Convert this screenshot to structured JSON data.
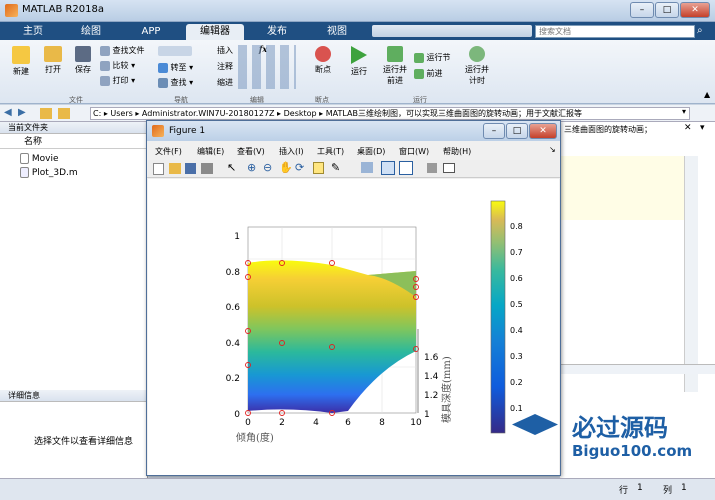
{
  "app": {
    "title": "MATLAB R2018a"
  },
  "tabs": [
    "主页",
    "绘图",
    "APP",
    "编辑器",
    "发布",
    "视图"
  ],
  "active_tab": 3,
  "search": {
    "placeholder": "搜索文档"
  },
  "ribbon": {
    "file": {
      "new": "新建",
      "open": "打开",
      "save": "保存",
      "find_files": "查找文件",
      "compare": "比较",
      "print": "打印",
      "group": "文件"
    },
    "nav": {
      "goto": "转至",
      "find": "查找",
      "group": "导航"
    },
    "edit": {
      "insert": "插入",
      "comment": "注释",
      "indent": "缩进",
      "group": "编辑"
    },
    "breakpoints": {
      "label": "断点",
      "group": "断点"
    },
    "run": {
      "run": "运行",
      "run_advance": "运行并\n前进",
      "run_section": "运行节",
      "advance": "前进",
      "run_time": "运行并\n计时",
      "group": "运行"
    }
  },
  "address": {
    "path": "C: ▸ Users ▸ Administrator.WIN7U-20180127Z ▸ Desktop ▸ MATLAB三维绘制图，可以实现三维曲面图的旋转动画；用于文献汇报等"
  },
  "left_pane": {
    "header": "当前文件夹",
    "col_name": "名称",
    "files": [
      "Movie",
      "Plot_3D.m"
    ],
    "details_header": "详细信息",
    "details_msg": "选择文件以查看详细信息"
  },
  "editor_tab_text": "三维曲面图的旋转动画；",
  "figure": {
    "title": "Figure 1",
    "menu": [
      "文件(F)",
      "编辑(E)",
      "查看(V)",
      "插入(I)",
      "工具(T)",
      "桌面(D)",
      "窗口(W)",
      "帮助(H)"
    ],
    "xlabel": "倾角(度)",
    "zlabel": "模具深度(mm)",
    "x_ticks": [
      "0",
      "2",
      "4",
      "6",
      "8",
      "10"
    ],
    "y_ticks": [
      "0",
      "0.2",
      "0.4",
      "0.6",
      "0.8",
      "1"
    ],
    "z_ticks": [
      "1",
      "1.2",
      "1.4",
      "1.6"
    ],
    "colorbar_ticks": [
      "0.1",
      "0.2",
      "0.3",
      "0.4",
      "0.5",
      "0.6",
      "0.7",
      "0.8"
    ]
  },
  "status": {
    "row_label": "行",
    "row": "1",
    "col_label": "列",
    "col": "1"
  },
  "watermark": {
    "text": "必过源码",
    "url": "Biguo100.com"
  }
}
